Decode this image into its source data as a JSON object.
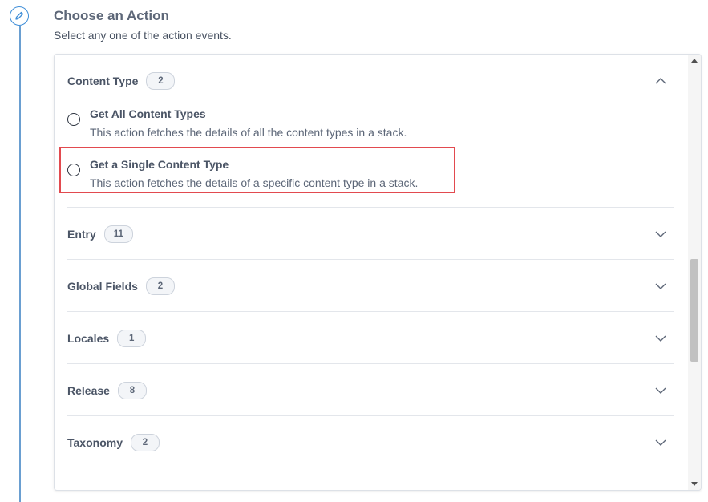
{
  "step": {
    "icon": "pencil-icon",
    "heading": "Choose an Action",
    "subheading": "Select any one of the action events."
  },
  "groups": [
    {
      "title": "Content Type",
      "count": "2",
      "expanded": true,
      "options": [
        {
          "title": "Get All Content Types",
          "description": "This action fetches the details of all the content types in a stack.",
          "selected": false
        },
        {
          "title": "Get a Single Content Type",
          "description": "This action fetches the details of a specific content type in a stack.",
          "selected": false,
          "highlighted": true
        }
      ]
    },
    {
      "title": "Entry",
      "count": "11",
      "expanded": false
    },
    {
      "title": "Global Fields",
      "count": "2",
      "expanded": false
    },
    {
      "title": "Locales",
      "count": "1",
      "expanded": false
    },
    {
      "title": "Release",
      "count": "8",
      "expanded": false
    },
    {
      "title": "Taxonomy",
      "count": "2",
      "expanded": false
    }
  ],
  "colors": {
    "accent": "#3f8ed8",
    "highlight": "#e24a4f",
    "text": "#4b5566"
  }
}
